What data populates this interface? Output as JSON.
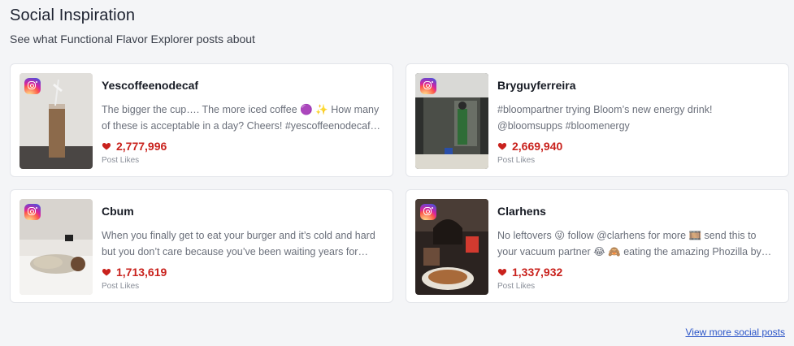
{
  "header": {
    "title": "Social Inspiration",
    "subtitle": "See what Functional Flavor Explorer posts about"
  },
  "posts": [
    {
      "platform_icon": "instagram-icon",
      "author": "Yescoffeenodecaf",
      "caption": "The bigger the cup…. The more iced coffee 🟣 ✨ How many of these is acceptable in a day? Cheers! #yescoffeenodecaf…",
      "likes": "2,777,996",
      "likes_label": "Post Likes"
    },
    {
      "platform_icon": "instagram-icon",
      "author": "Bryguyferreira",
      "caption": "#bloompartner trying Bloom’s new energy drink! @bloomsupps #bloomenergy",
      "likes": "2,669,940",
      "likes_label": "Post Likes"
    },
    {
      "platform_icon": "instagram-icon",
      "author": "Cbum",
      "caption": "When you finally get to eat your burger and it’s cold and hard but you don’t care because you’ve been waiting years for this…",
      "likes": "1,713,619",
      "likes_label": "Post Likes"
    },
    {
      "platform_icon": "instagram-icon",
      "author": "Clarhens",
      "caption": "No leftovers 😜 follow @clarhens for more 🎞️ send this to your vacuum partner 😂 🙈 eating the amazing Phozilla by…",
      "likes": "1,337,932",
      "likes_label": "Post Likes"
    }
  ],
  "footer": {
    "view_more": "View more social posts"
  },
  "colors": {
    "likes": "#c9221d",
    "link": "#2b55c8"
  }
}
